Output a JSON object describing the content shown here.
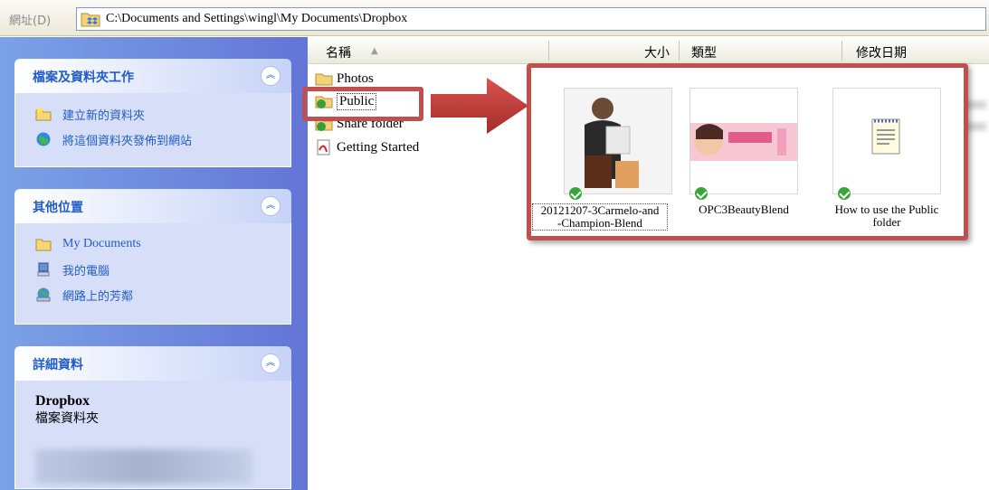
{
  "address_bar": {
    "label": "網址(D)",
    "path": "C:\\Documents and Settings\\wingl\\My Documents\\Dropbox"
  },
  "task_pane": {
    "file_tasks": {
      "title": "檔案及資料夾工作",
      "items": [
        {
          "label": "建立新的資料夾",
          "icon": "new-folder-icon"
        },
        {
          "label": "將這個資料夾發佈到網站",
          "icon": "publish-web-icon"
        }
      ]
    },
    "other_places": {
      "title": "其他位置",
      "items": [
        {
          "label": "My Documents",
          "icon": "folder-icon"
        },
        {
          "label": "我的電腦",
          "icon": "computer-icon"
        },
        {
          "label": "網路上的芳鄰",
          "icon": "network-icon"
        }
      ]
    },
    "details": {
      "title": "詳細資料",
      "name": "Dropbox",
      "type": "檔案資料夾"
    }
  },
  "columns": {
    "name": "名稱",
    "size": "大小",
    "type": "類型",
    "modified": "修改日期"
  },
  "tree": [
    {
      "label": "Photos",
      "icon": "folder-icon"
    },
    {
      "label": "Public",
      "icon": "shared-folder-icon"
    },
    {
      "label": "Share folder",
      "icon": "shared-folder-icon"
    },
    {
      "label": "Getting Started",
      "icon": "pdf-icon"
    }
  ],
  "preview_files": [
    {
      "name": "20121207-3Carmelo-and-Champion-Blend",
      "line1": "20121207-3Carmelo-and",
      "line2": "-Champion-Blend",
      "thumb": "photo-person-product"
    },
    {
      "name": "OPC3BeautyBlend",
      "line1": "OPC3BeautyBlend",
      "line2": "",
      "thumb": "photo-beauty-banner"
    },
    {
      "name": "How to use the Public folder",
      "line1": "How to use the Public",
      "line2": "folder",
      "thumb": "text-document-icon"
    }
  ],
  "colors": {
    "annotation": "#c0504d",
    "xp_blue": "#215dc6",
    "sync_ok": "#3aa63a"
  }
}
